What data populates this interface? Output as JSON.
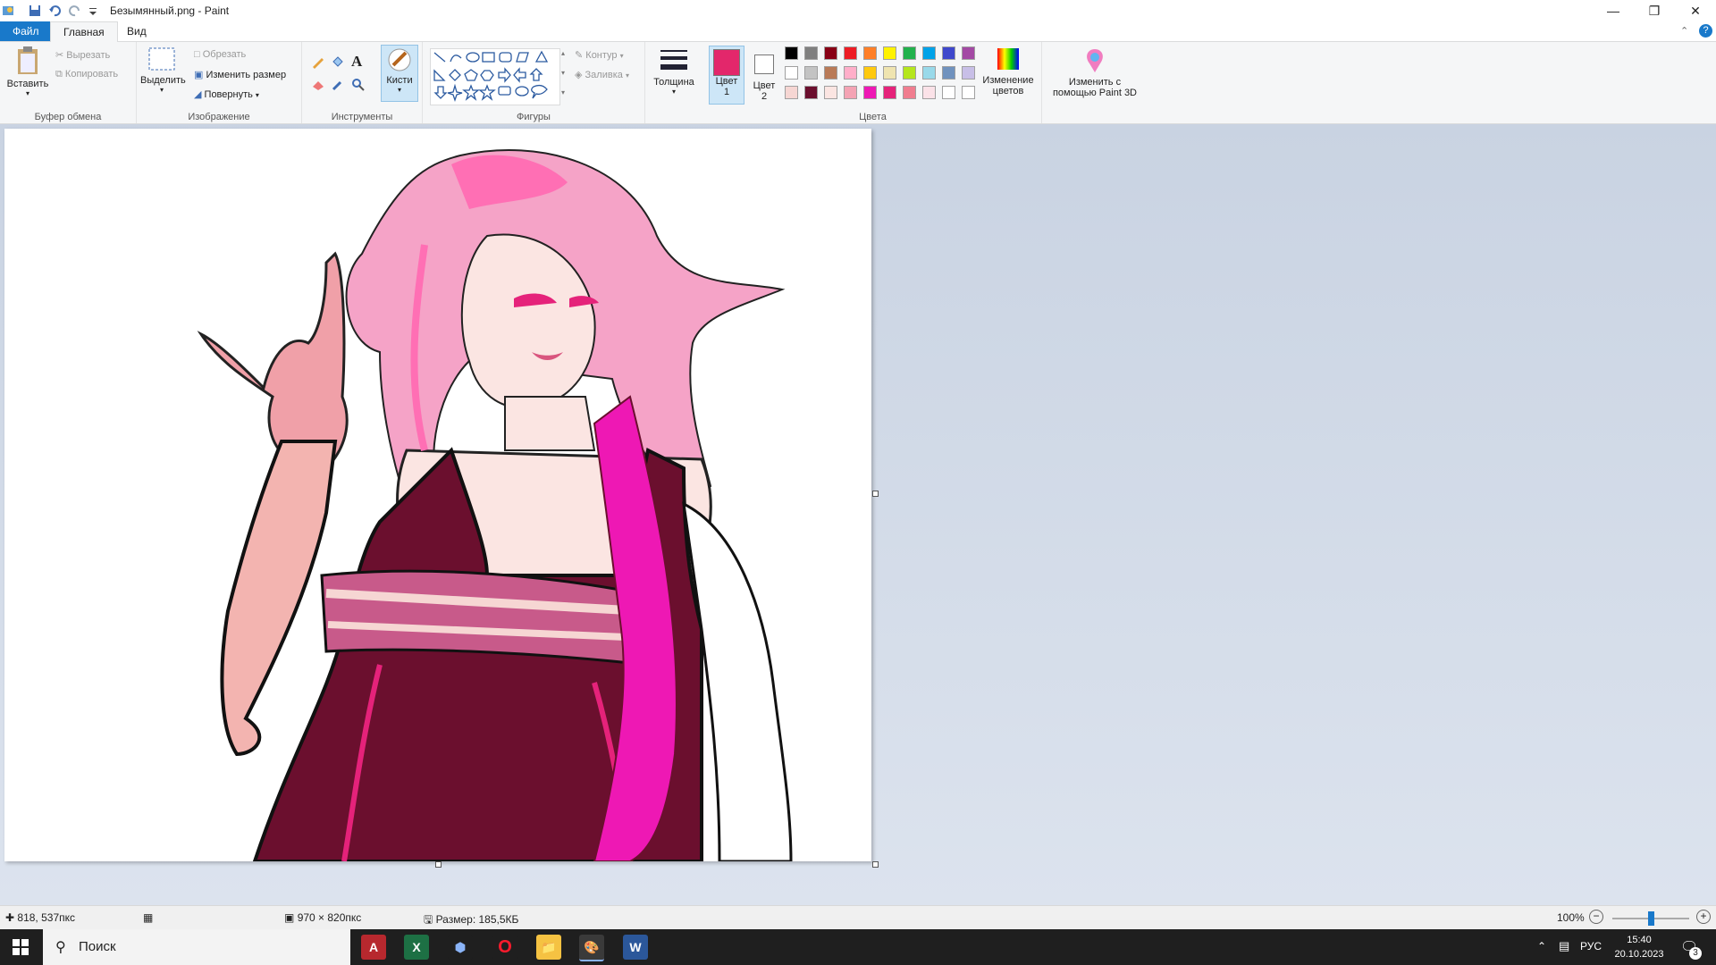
{
  "window": {
    "title": "Безымянный.png - Paint",
    "minimize_icon": "minimize-icon",
    "restore_icon": "restore-icon",
    "close_icon": "close-icon"
  },
  "tabs": {
    "file": "Файл",
    "home": "Главная",
    "view": "Вид"
  },
  "clipboard": {
    "paste": "Вставить",
    "cut": "Вырезать",
    "copy": "Копировать",
    "label": "Буфер обмена"
  },
  "image": {
    "select": "Выделить",
    "crop": "Обрезать",
    "resize": "Изменить размер",
    "rotate": "Повернуть",
    "label": "Изображение"
  },
  "tools": {
    "brushes": "Кисти",
    "label": "Инструменты"
  },
  "shapes": {
    "outline": "Контур",
    "fill": "Заливка",
    "label": "Фигуры"
  },
  "thickness": {
    "label": "Толщина"
  },
  "colors": {
    "color1_line1": "Цвет",
    "color1_line2": "1",
    "color2_line1": "Цвет",
    "color2_line2": "2",
    "color1": "#e3276b",
    "color2": "#ffffff",
    "edit_line1": "Изменение",
    "edit_line2": "цветов",
    "label": "Цвета",
    "palette": [
      "#000000",
      "#7f7f7f",
      "#880015",
      "#ed1c24",
      "#ff7f27",
      "#fff200",
      "#22b14c",
      "#00a2e8",
      "#3f48cc",
      "#a349a4",
      "#ffffff",
      "#c3c3c3",
      "#b97a57",
      "#ffaec9",
      "#ffc90e",
      "#efe4b0",
      "#b5e61d",
      "#99d9ea",
      "#7092be",
      "#c8bfe7",
      "#f6d6d3",
      "#6b0f2e",
      "#fbe5e2",
      "#f4a3b4",
      "#ee18b4",
      "#e5227a",
      "#f07d8f",
      "#fbe2e8",
      "#ffffff",
      "#ffffff"
    ]
  },
  "paint3d": {
    "line1": "Изменить с",
    "line2": "помощью Paint 3D"
  },
  "status": {
    "cursor": "818, 537пкс",
    "dimensions": "970 × 820пкс",
    "size": "Размер: 185,5КБ",
    "zoom": "100%",
    "zoom_level": 0.5
  },
  "taskbar": {
    "search": "Поиск",
    "lang": "РУС",
    "time": "15:40",
    "date": "20.10.2023",
    "notifications": "3"
  }
}
